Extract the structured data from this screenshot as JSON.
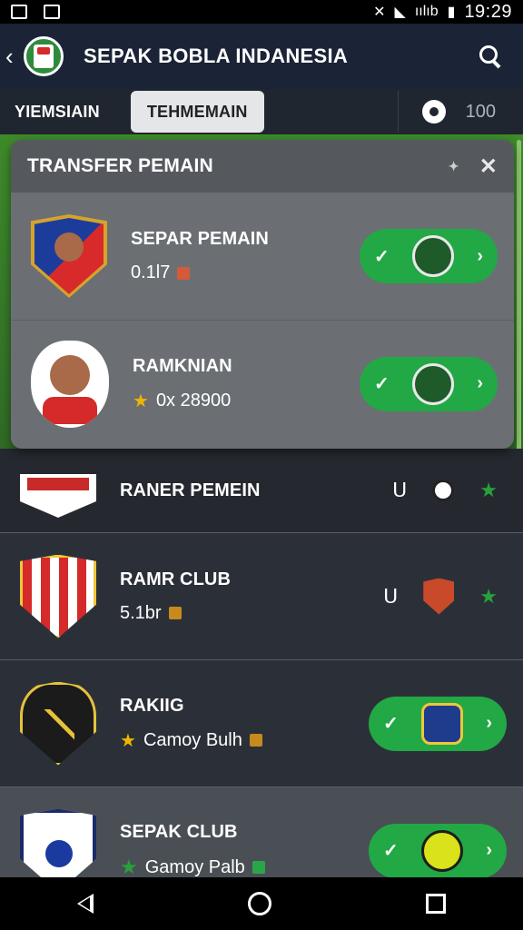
{
  "status_bar": {
    "time": "19:29",
    "signal_text": "ıılıb"
  },
  "app_bar": {
    "title": "SEPAK BOBLA INDANESIA",
    "back_icon": "chevron-left-icon",
    "search_icon": "search-icon"
  },
  "tabs": [
    {
      "label": "YIEMSIAIN",
      "active": false
    },
    {
      "label": "TEHMEMAIN",
      "active": true
    }
  ],
  "coins": {
    "icon": "coin-icon",
    "value": "100"
  },
  "card": {
    "title": "TRANSFER PEMAIN",
    "rows": [
      {
        "name": "SEPAR PEMAIN",
        "sub": "0.1l7"
      },
      {
        "name": "RAMKNIAN",
        "sub": "0x  28900"
      }
    ]
  },
  "list": [
    {
      "name": "RANER PEMEIN"
    },
    {
      "name": "RAMR CLUB",
      "sub": "5.1br"
    },
    {
      "name": "RAKIIG",
      "sub": "Camoy Bulh"
    },
    {
      "name": "SEPAK CLUB",
      "sub": "Gamoy Palb"
    }
  ],
  "colors": {
    "accent_green": "#22a845",
    "appbar": "#1a2436",
    "star_gold": "#f0b400"
  }
}
